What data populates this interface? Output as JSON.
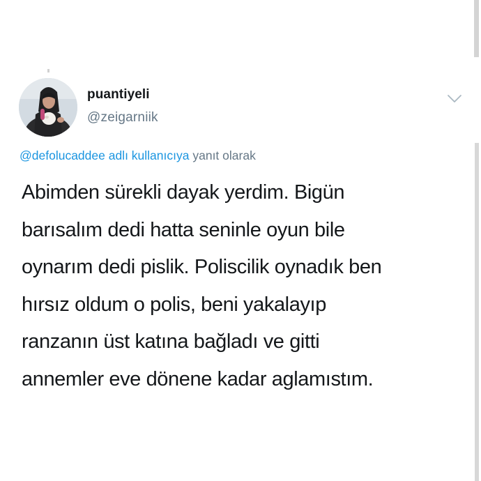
{
  "tweet": {
    "display_name": "puantiyeli",
    "handle": "@zeigarniik",
    "reply_mention": "@defolucaddee adlı kullanıcıya",
    "reply_suffix": "yanıt olarak",
    "lines": [
      "Abimden sürekli dayak yerdim. Bigün",
      "barısalım dedi hatta seninle oyun bile",
      "oynarım dedi pislik. Poliscilik oynadık ben",
      "hırsız oldum o polis, beni yakalayıp",
      "ranzanın üst katına bağladı ve gitti",
      "annemler eve dönene kadar aglamıstım."
    ]
  },
  "icons": {
    "menu": "chevron-down-icon",
    "avatar": "profile-photo"
  },
  "colors": {
    "text": "#14171a",
    "secondary": "#657786",
    "link": "#1b95e0",
    "background": "#ffffff"
  }
}
